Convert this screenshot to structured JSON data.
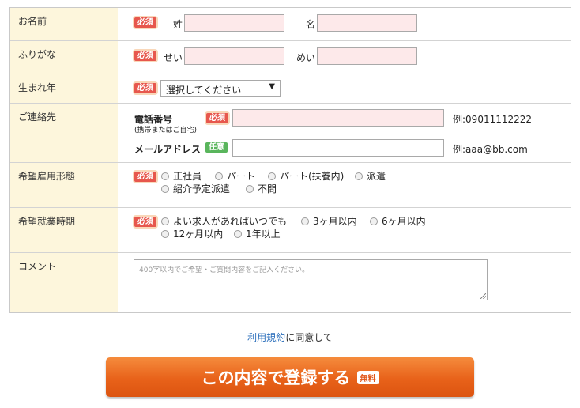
{
  "form": {
    "name": {
      "label": "お名前",
      "required": "必須",
      "last_label": "姓",
      "first_label": "名"
    },
    "kana": {
      "label": "ふりがな",
      "required": "必須",
      "last_label": "せい",
      "first_label": "めい"
    },
    "birth_year": {
      "label": "生まれ年",
      "required": "必須",
      "select_value": "選択してください"
    },
    "contact": {
      "label": "ご連絡先",
      "phone_label": "電話番号",
      "phone_note": "(携帯またはご自宅)",
      "phone_required": "必須",
      "phone_example": "例:09011112222",
      "email_label": "メールアドレス",
      "email_optional": "任意",
      "email_example": "例:aaa@bb.com"
    },
    "employment": {
      "label": "希望雇用形態",
      "required": "必須",
      "options": [
        "正社員",
        "パート",
        "パート(扶養内)",
        "派遣",
        "紹介予定派遣",
        "不問"
      ]
    },
    "start_time": {
      "label": "希望就業時期",
      "required": "必須",
      "options": [
        "よい求人があればいつでも",
        "3ヶ月以内",
        "6ヶ月以内",
        "12ヶ月以内",
        "1年以上"
      ]
    },
    "comment": {
      "label": "コメント",
      "placeholder": "400字以内でご希望・ご質問内容をご記入ください。"
    }
  },
  "agreement": {
    "link": "利用規約",
    "text": "に同意して"
  },
  "submit": {
    "label": "この内容で登録する",
    "free_badge": "無料"
  }
}
